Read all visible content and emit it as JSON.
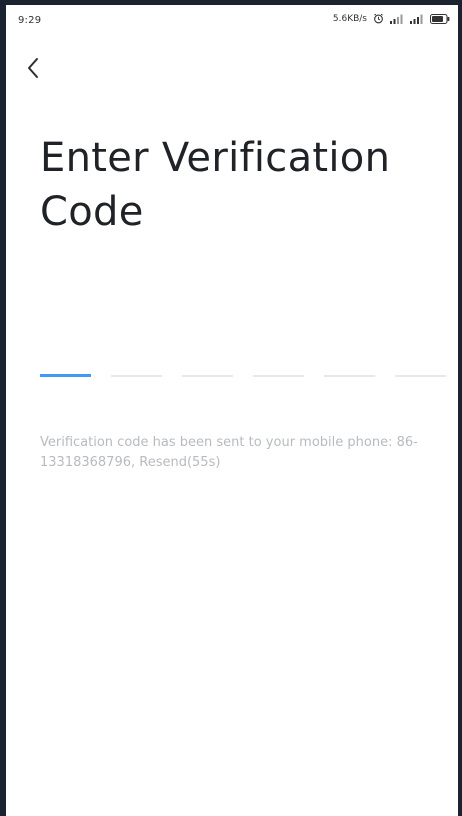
{
  "status_bar": {
    "time": "9:29",
    "network_speed": "5.6KB/s",
    "icons": [
      "alarm-icon",
      "signal-icon",
      "signal-icon",
      "battery-icon"
    ]
  },
  "nav": {
    "back_icon": "chevron-left-icon"
  },
  "title": {
    "line1": "Enter Verification",
    "line2": "Code"
  },
  "code_input": {
    "length": 6,
    "active_index": 0,
    "values": [
      "",
      "",
      "",
      "",
      "",
      ""
    ]
  },
  "hint": {
    "text": "Verification code has been sent to your mobile phone: 86-13318368796, ",
    "resend_label": "Resend(55s)"
  },
  "colors": {
    "active_line": "#3f9af5",
    "inactive_line": "#e6e8eb",
    "title": "#1f2226",
    "hint": "#b7bbc0"
  }
}
